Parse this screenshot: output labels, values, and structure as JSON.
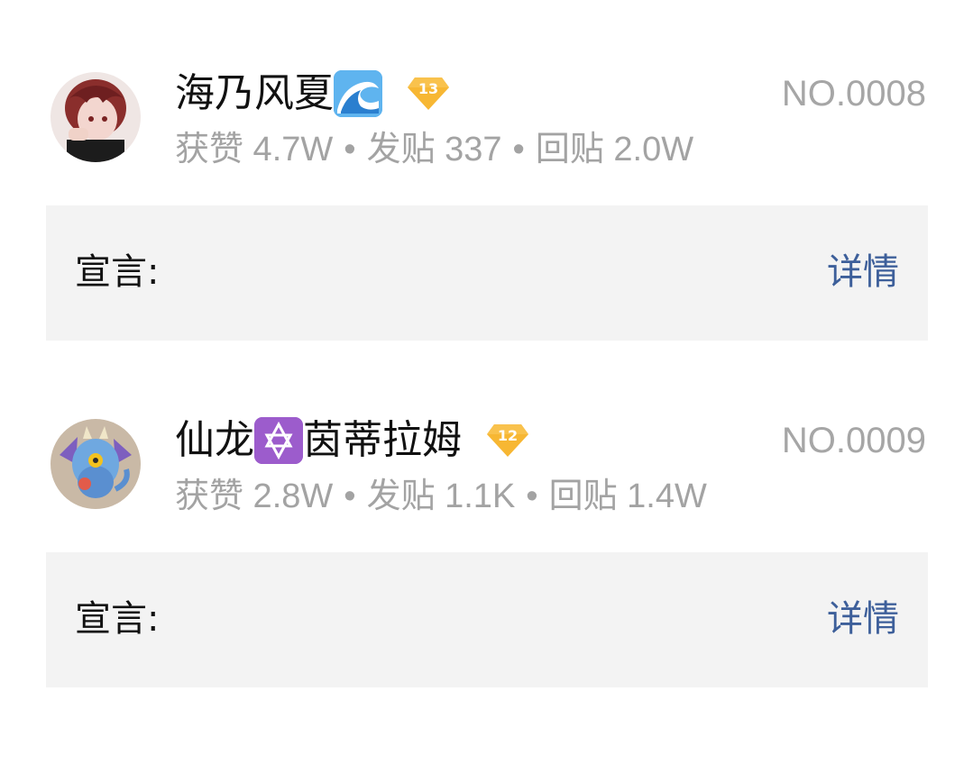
{
  "users": [
    {
      "name_part1": "海乃风夏",
      "name_emoji": "🌊",
      "name_emoji_icon": "water-wave-icon",
      "name_part2": "",
      "level": "13",
      "rank": "NO.0008",
      "stats": {
        "likes": "获赞 4.7W",
        "posts": "发贴 337",
        "replies": "回贴 2.0W",
        "separator": "•"
      },
      "manifesto_label": "宣言:",
      "detail_label": "详情"
    },
    {
      "name_part1": "仙龙",
      "name_emoji": "✡️",
      "name_emoji_icon": "star-of-david-icon",
      "name_part2": "茵蒂拉姆",
      "level": "12",
      "rank": "NO.0009",
      "stats": {
        "likes": "获赞 2.8W",
        "posts": "发贴 1.1K",
        "replies": "回贴 1.4W",
        "separator": "•"
      },
      "manifesto_label": "宣言:",
      "detail_label": "详情"
    }
  ],
  "colors": {
    "accent_link": "#3d5f9a",
    "badge_gold": "#f7b733",
    "muted_text": "#a3a3a3",
    "panel_bg": "#f3f3f3"
  }
}
